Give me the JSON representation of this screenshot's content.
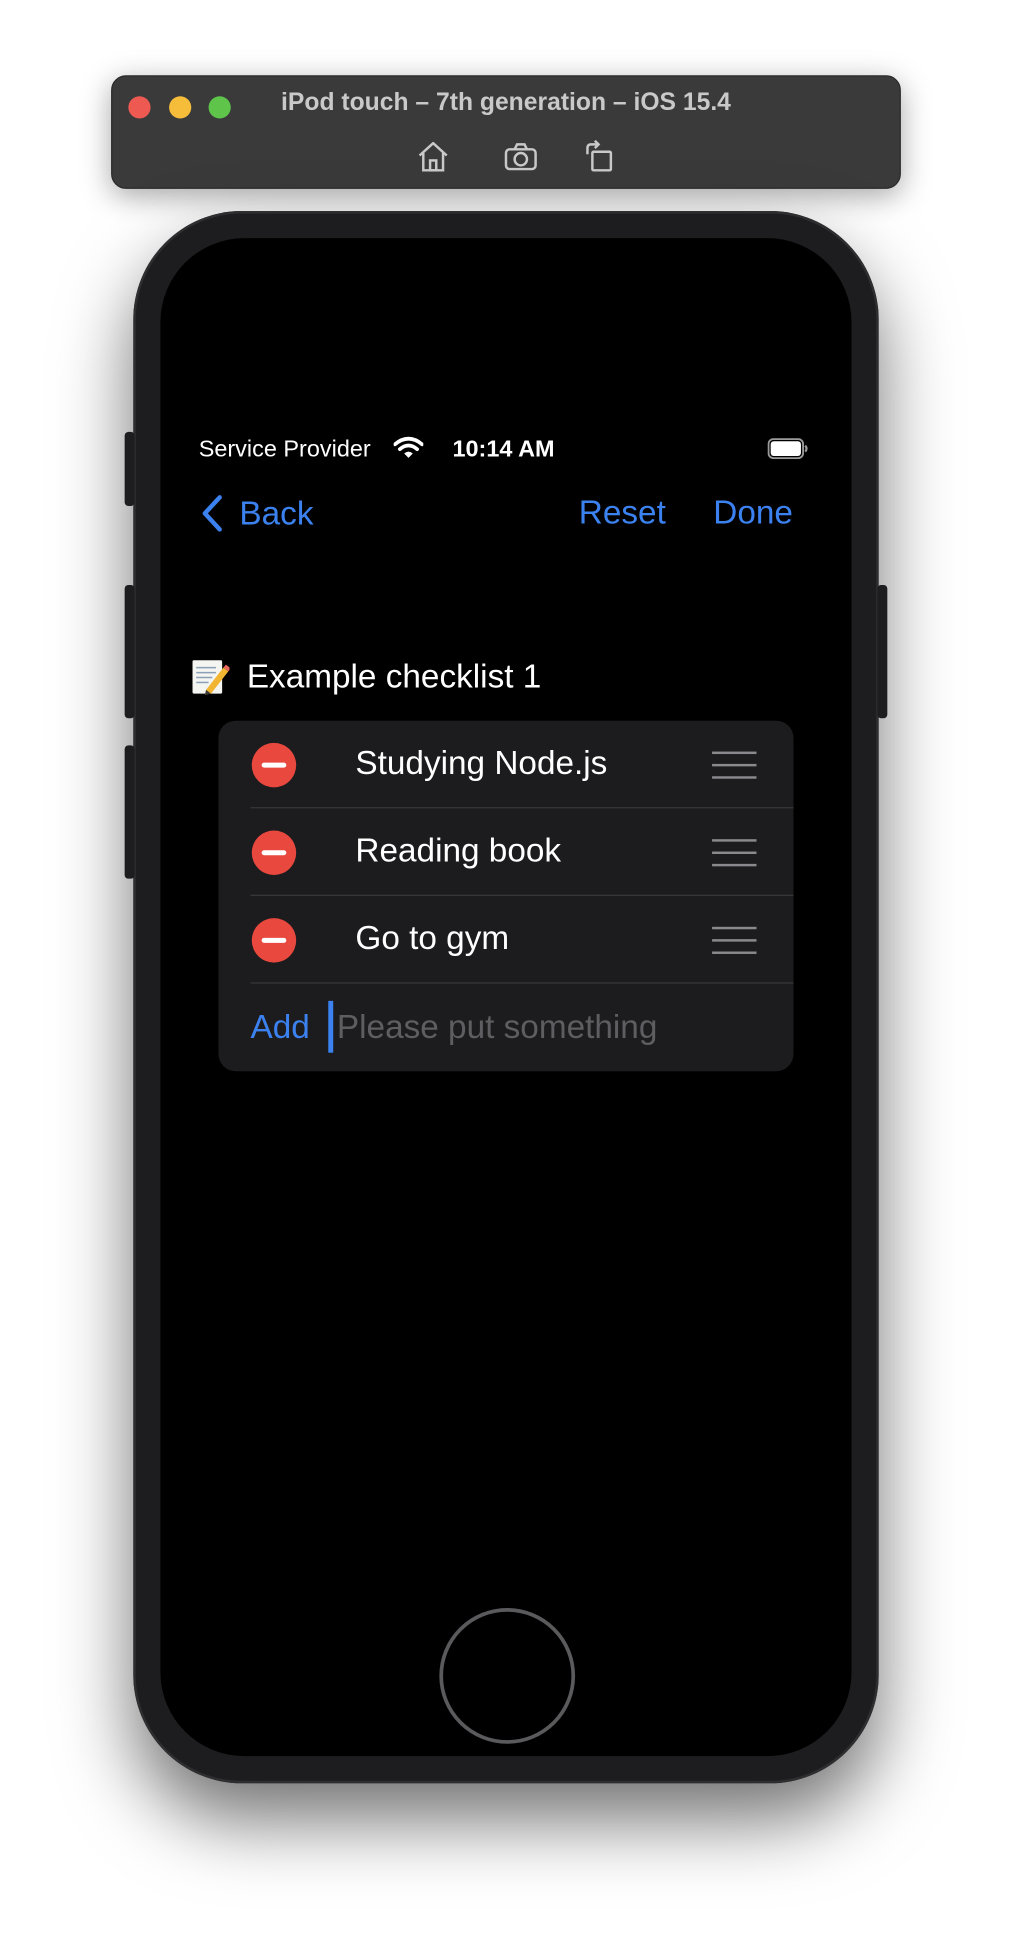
{
  "simulator": {
    "window_title": "iPod touch – 7th generation – iOS 15.4",
    "tools": [
      {
        "icon": "home-icon"
      },
      {
        "icon": "screenshot-camera-icon"
      },
      {
        "icon": "rotate-icon"
      }
    ]
  },
  "status_bar": {
    "carrier": "Service Provider",
    "time": "10:14 AM",
    "icons": [
      "wifi-icon",
      "battery-icon"
    ]
  },
  "nav": {
    "back_label": "Back",
    "reset_label": "Reset",
    "done_label": "Done"
  },
  "checklist": {
    "icon": "memo-icon",
    "title": "Example checklist 1",
    "items": [
      {
        "label": "Studying Node.js"
      },
      {
        "label": "Reading book"
      },
      {
        "label": "Go to gym"
      }
    ],
    "add_label": "Add",
    "add_placeholder": "Please put something",
    "add_value": ""
  },
  "colors": {
    "accent": "#3b82f0",
    "delete": "#e9483e",
    "background": "#000000",
    "card": "#1c1c1e"
  }
}
